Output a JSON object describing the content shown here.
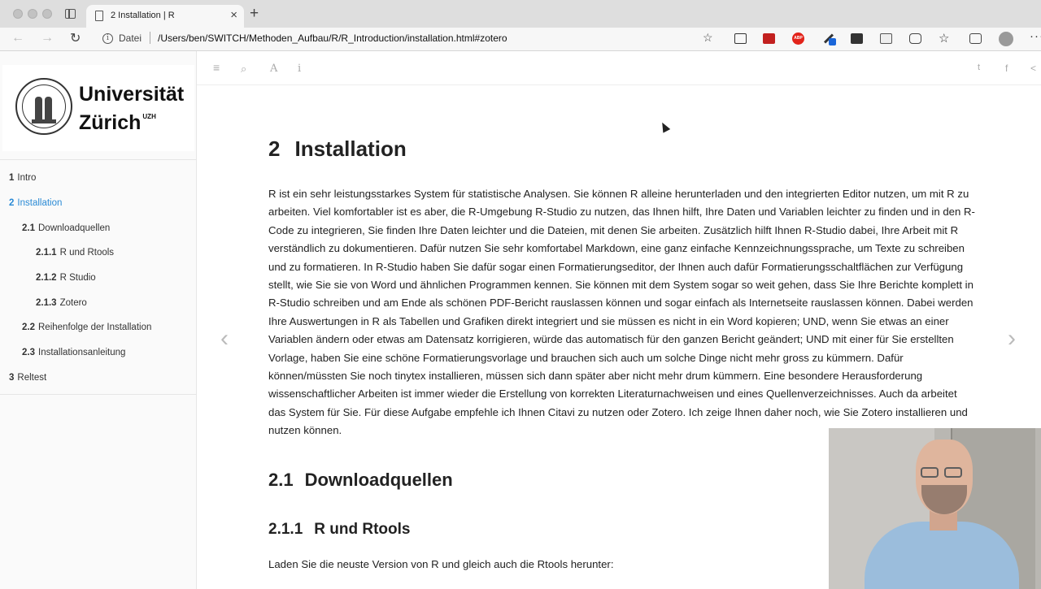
{
  "browser": {
    "tab_title": "2 Installation | R",
    "tab_close": "×",
    "new_tab": "+",
    "url_scheme": "Datei",
    "url": "/Users/ben/SWITCH/Methoden_Aufbau/R/R_Introduction/installation.html#zotero",
    "abp_label": "ABP"
  },
  "sidebar": {
    "logo_line1": "Universität",
    "logo_line2": "Zürich",
    "logo_sup": "UZH",
    "toc": [
      {
        "num": "1",
        "label": "Intro"
      },
      {
        "num": "2",
        "label": "Installation"
      },
      {
        "num": "2.1",
        "label": "Downloadquellen"
      },
      {
        "num": "2.1.1",
        "label": "R und Rtools"
      },
      {
        "num": "2.1.2",
        "label": "R Studio"
      },
      {
        "num": "2.1.3",
        "label": "Zotero"
      },
      {
        "num": "2.2",
        "label": "Reihenfolge der Installation"
      },
      {
        "num": "2.3",
        "label": "Installationsanleitung"
      },
      {
        "num": "3",
        "label": "Reltest"
      }
    ]
  },
  "toolbar": {
    "menu_icon": "≡",
    "search_icon": "⌕",
    "font_icon": "A",
    "info_icon": "i",
    "twitter_icon": "t",
    "facebook_icon": "f",
    "share_icon": "<"
  },
  "content": {
    "chapter_num": "2",
    "chapter_title": "Installation",
    "paragraph": "R ist ein sehr leistungsstarkes System für statistische Analysen. Sie können R alleine herunterladen und den integrierten Editor nutzen, um mit R zu arbeiten. Viel komfortabler ist es aber, die R-Umgebung R-Studio zu nutzen, das Ihnen hilft, Ihre Daten und Variablen leichter zu finden und in den R-Code zu integrieren, Sie finden Ihre Daten leichter und die Dateien, mit denen Sie arbeiten. Zusätzlich hilft Ihnen R-Studio dabei, Ihre Arbeit mit R verständlich zu dokumentieren. Dafür nutzen Sie sehr komfortabel Markdown, eine ganz einfache Kennzeichnungssprache, um Texte zu schreiben und zu formatieren. In R-Studio haben Sie dafür sogar einen Formatierungseditor, der Ihnen auch dafür Formatierungsschaltflächen zur Verfügung stellt, wie Sie sie von Word und ähnlichen Programmen kennen. Sie können mit dem System sogar so weit gehen, dass Sie Ihre Berichte komplett in R-Studio schreiben und am Ende als schönen PDF-Bericht rauslassen können und sogar einfach als Internetseite rauslassen können. Dabei werden Ihre Auswertungen in R als Tabellen und Grafiken direkt integriert und sie müssen es nicht in ein Word kopieren; UND, wenn Sie etwas an einer Variablen ändern oder etwas am Datensatz korrigieren, würde das automatisch für den ganzen Bericht geändert; UND mit einer für Sie erstellten Vorlage, haben Sie eine schöne Formatierungsvorlage und brauchen sich auch um solche Dinge nicht mehr gross zu kümmern. Dafür können/müssten Sie noch tinytex installieren, müssen sich dann später aber nicht mehr drum kümmern. Eine besondere Herausforderung wissenschaftlicher Arbeiten ist immer wieder die Erstellung von korrekten Literaturnachweisen und eines Quellenverzeichnisses. Auch da arbeitet das System für Sie. Für diese Aufgabe empfehle ich Ihnen Citavi zu nutzen oder Zotero. Ich zeige Ihnen daher noch, wie Sie Zotero installieren und nutzen können.",
    "section_num": "2.1",
    "section_title": "Downloadquellen",
    "subsection_num": "2.1.1",
    "subsection_title": "R und Rtools",
    "paragraph2": "Laden Sie die neuste Version von R und gleich auch die Rtools herunter:",
    "prev_arrow": "‹",
    "next_arrow": "›"
  }
}
